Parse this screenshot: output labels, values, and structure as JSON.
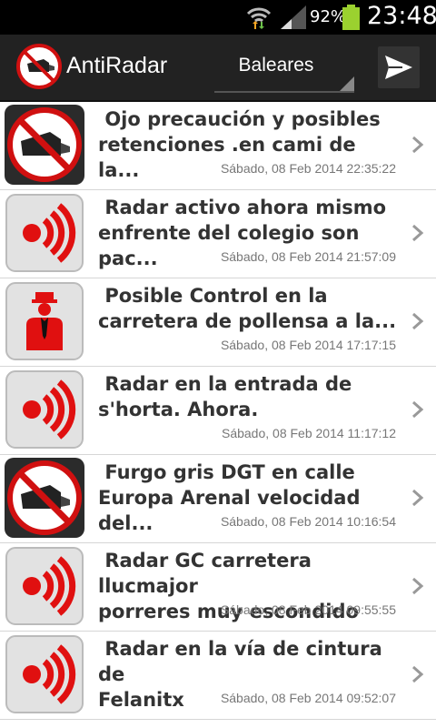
{
  "status_bar": {
    "battery_percent": "92%",
    "time": "23:48",
    "icons": [
      "wifi-icon",
      "signal-icon",
      "battery-icon"
    ]
  },
  "action_bar": {
    "app_title": "AntiRadar",
    "region": "Baleares",
    "icons": [
      "app-logo-icon",
      "send-icon"
    ]
  },
  "list": {
    "items": [
      {
        "title": " Ojo precaución y posibles\nretenciones .en cami de la...",
        "date": "Sábado, 08 Feb 2014 22:35:22",
        "icon": "no-camera-icon"
      },
      {
        "title": " Radar activo ahora mismo\nenfrente del colegio son pac...",
        "date": "Sábado, 08 Feb 2014 21:57:09",
        "icon": "radar-signal-icon"
      },
      {
        "title": " Posible Control en la\ncarretera de pollensa a la...",
        "date": "Sábado, 08 Feb 2014 17:17:15",
        "icon": "police-officer-icon"
      },
      {
        "title": " Radar en la entrada de\ns'horta. Ahora.",
        "date": "Sábado, 08 Feb 2014 11:17:12",
        "icon": "radar-signal-icon"
      },
      {
        "title": " Furgo gris DGT en calle\nEuropa Arenal velocidad del...",
        "date": "Sábado, 08 Feb 2014 10:16:54",
        "icon": "no-camera-icon"
      },
      {
        "title": " Radar GC carretera llucmajor\nporreres muy escondido",
        "date": "Sábado, 08 Feb 2014 09:55:55",
        "icon": "radar-signal-icon"
      },
      {
        "title": " Radar en la vía de cintura de\nFelanitx",
        "date": "Sábado, 08 Feb 2014 09:52:07",
        "icon": "radar-signal-icon"
      }
    ]
  },
  "colors": {
    "accent_red": "#e01010",
    "action_bar": "#222222",
    "status_bar": "#000000",
    "battery": "#9bd12f"
  }
}
